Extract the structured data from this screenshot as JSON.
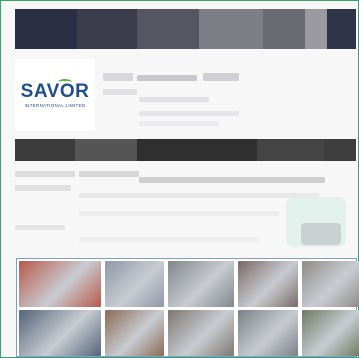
{
  "logo": {
    "word_part1": "SAV",
    "word_o": "O",
    "word_part2": "R",
    "subtitle": "INTERNATIONAL LIMITED",
    "colors": {
      "text": "#1f4e8c",
      "swoosh": "#5fb246"
    }
  },
  "colors": {
    "frame_border": "#3aa36a",
    "gallery_border": "#7f9ad6",
    "nav_blocks": [
      "#2b2f44",
      "#3a3b4b",
      "#565662",
      "#7d7d86",
      "#6a6a72",
      "#9a9aa0",
      "#2f3448"
    ],
    "dark_bar_blocks": [
      "#3b3b3b",
      "#555555",
      "#2f2f2f",
      "#444444",
      "#3d3d3d"
    ],
    "thumbnails": [
      "#b75a4a",
      "#8f98a8",
      "#80868c",
      "#7a6a66",
      "#8f8c88",
      "#55647a",
      "#8a6a55",
      "#7e7670",
      "#7a8088",
      "#6e7a62"
    ]
  }
}
